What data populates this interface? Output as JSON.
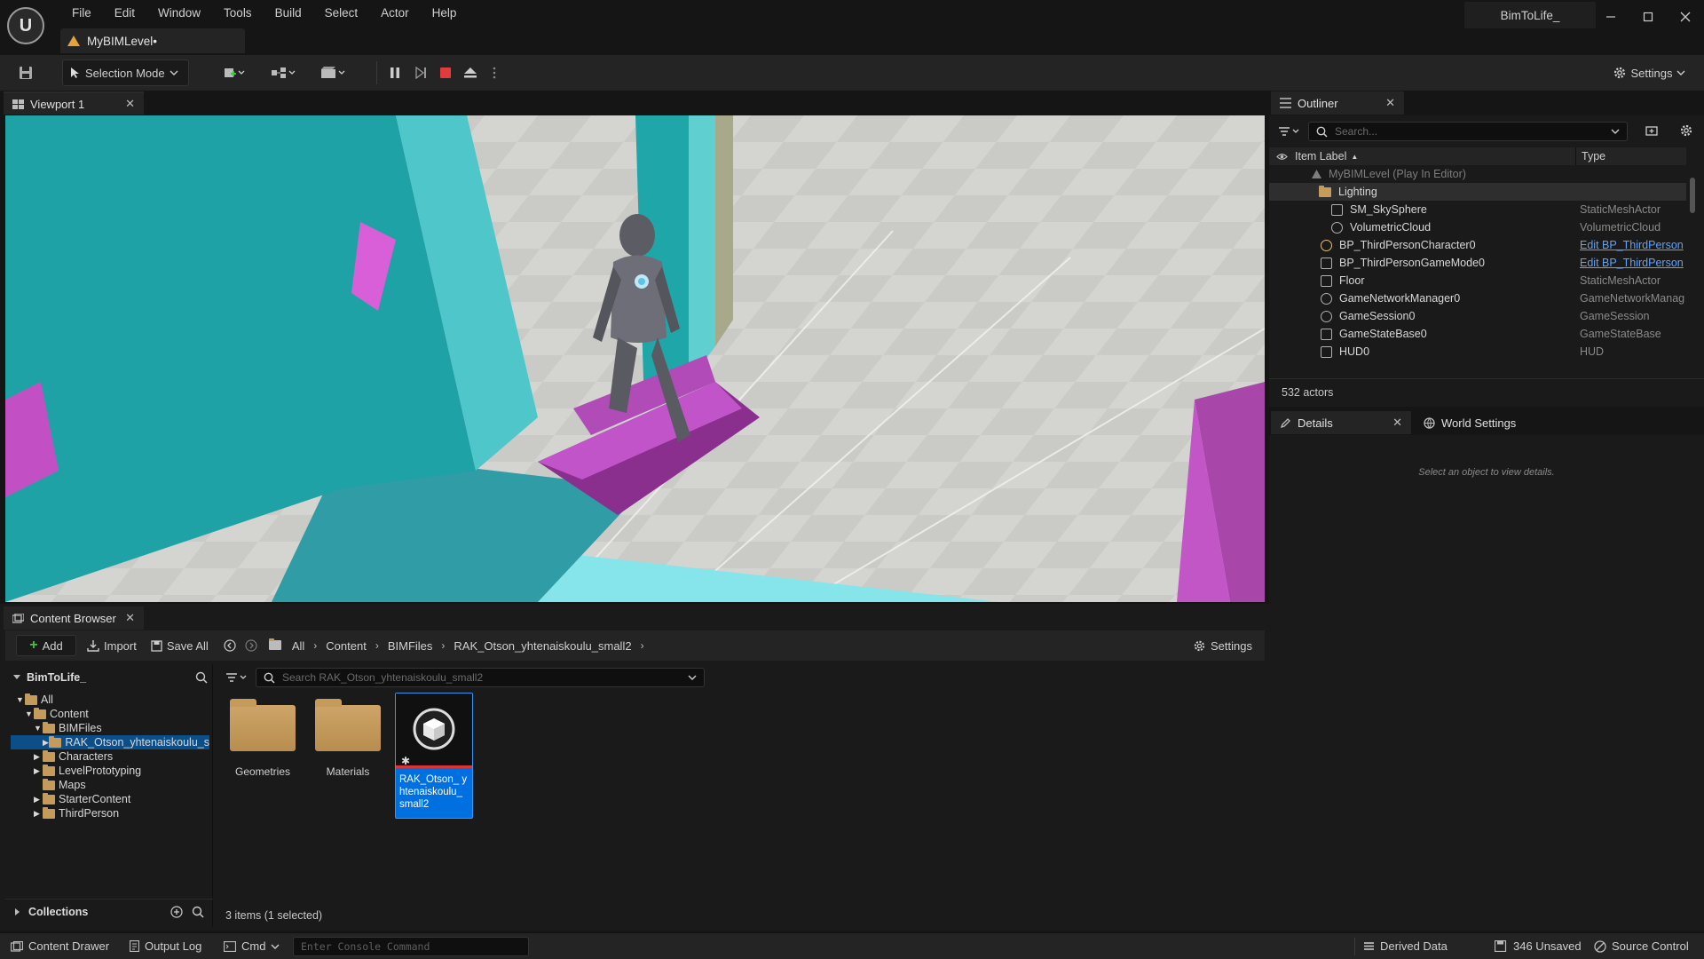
{
  "menubar": [
    "File",
    "Edit",
    "Window",
    "Tools",
    "Build",
    "Select",
    "Actor",
    "Help"
  ],
  "level_tab": "MyBIMLevel•",
  "app_title": "BimToLife_",
  "toolbar": {
    "selection_mode": "Selection Mode",
    "settings": "Settings"
  },
  "viewport": {
    "tab": "Viewport 1"
  },
  "content_browser": {
    "tab": "Content Browser",
    "add": "Add",
    "import": "Import",
    "save_all": "Save All",
    "breadcrumb": [
      "All",
      "Content",
      "BIMFiles",
      "RAK_Otson_yhtenaiskoulu_small2"
    ],
    "settings": "Settings",
    "project": "BimToLife_",
    "tree": [
      "All",
      "Content",
      "BIMFiles",
      "RAK_Otson_yhtenaiskoulu_s",
      "Characters",
      "LevelPrototyping",
      "Maps",
      "StarterContent",
      "ThirdPerson"
    ],
    "search_placeholder": "Search RAK_Otson_yhtenaiskoulu_small2",
    "assets": [
      "Geometries",
      "Materials",
      "RAK_Otson_ yhtenaiskoulu_ small2"
    ],
    "collections": "Collections",
    "status": "3 items (1 selected)"
  },
  "outliner": {
    "tab": "Outliner",
    "search_placeholder": "Search...",
    "col_label": "Item Label",
    "col_type": "Type",
    "root": "MyBIMLevel (Play In Editor)",
    "lighting_folder": "Lighting",
    "rows": [
      {
        "label": "SM_SkySphere",
        "type": "StaticMeshActor"
      },
      {
        "label": "VolumetricCloud",
        "type": "VolumetricCloud"
      },
      {
        "label": "BP_ThirdPersonCharacter0",
        "type": "Edit BP_ThirdPerson"
      },
      {
        "label": "BP_ThirdPersonGameMode0",
        "type": "Edit BP_ThirdPerson"
      },
      {
        "label": "Floor",
        "type": "StaticMeshActor"
      },
      {
        "label": "GameNetworkManager0",
        "type": "GameNetworkManag"
      },
      {
        "label": "GameSession0",
        "type": "GameSession"
      },
      {
        "label": "GameStateBase0",
        "type": "GameStateBase"
      },
      {
        "label": "HUD0",
        "type": "HUD"
      }
    ],
    "actor_count": "532 actors"
  },
  "details": {
    "tab": "Details",
    "world_settings_tab": "World Settings",
    "empty_message": "Select an object to view details."
  },
  "statusbar": {
    "content_drawer": "Content Drawer",
    "output_log": "Output Log",
    "cmd": "Cmd",
    "console_placeholder": "Enter Console Command",
    "derived_data": "Derived Data",
    "unsaved": "346 Unsaved",
    "source_control": "Source Control"
  },
  "colors": {
    "selection_blue": "#0070e0",
    "link_blue": "#5da3ff",
    "stop_red": "#e23b3b"
  }
}
